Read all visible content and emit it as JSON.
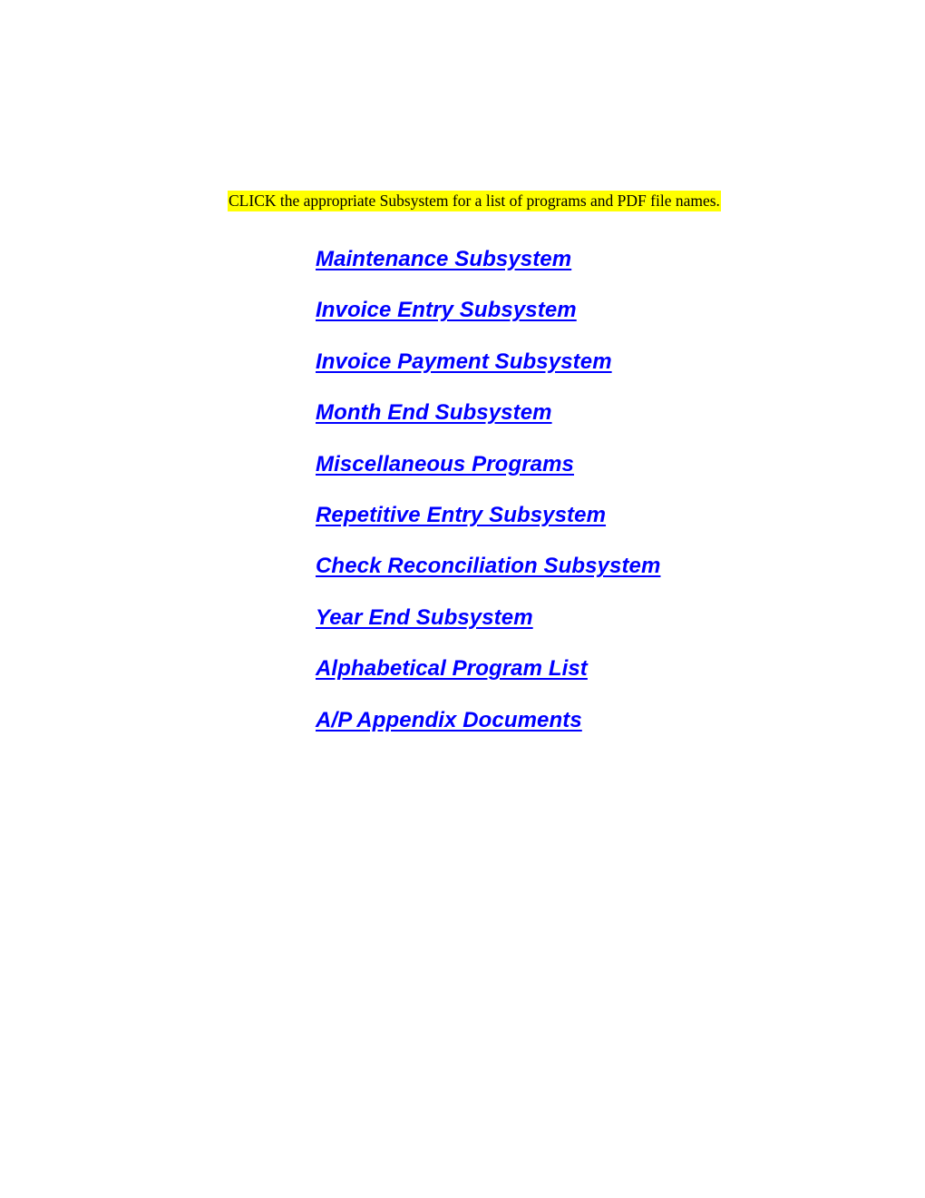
{
  "document": {
    "background_color": "#FFFFFF",
    "instruction": {
      "text": "CLICK the appropriate Subsystem for a list of programs and PDF file names.",
      "highlight_color": "#FFFF00",
      "text_color": "#000000"
    },
    "link_color": "#0000FF",
    "links": [
      {
        "label": "Maintenance Subsystem"
      },
      {
        "label": "Invoice Entry Subsystem"
      },
      {
        "label": "Invoice Payment Subsystem"
      },
      {
        "label": "Month End Subsystem"
      },
      {
        "label": "Miscellaneous Programs"
      },
      {
        "label": "Repetitive Entry Subsystem"
      },
      {
        "label": "Check Reconciliation Subsystem"
      },
      {
        "label": "Year End Subsystem"
      },
      {
        "label": "Alphabetical Program List"
      },
      {
        "label": "A/P Appendix Documents"
      }
    ]
  }
}
